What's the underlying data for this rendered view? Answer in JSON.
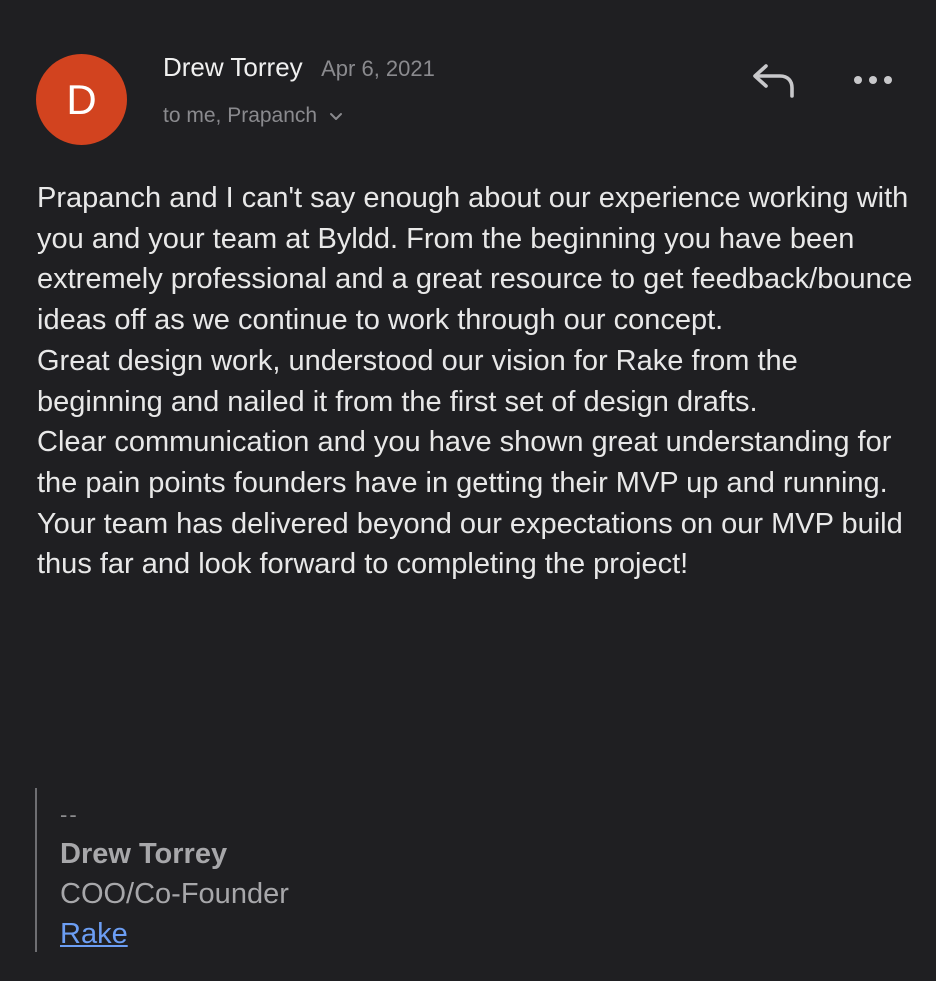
{
  "sender": {
    "initial": "D",
    "name": "Drew Torrey",
    "date": "Apr 6, 2021",
    "recipients": "to me, Prapanch"
  },
  "actions": {
    "reply_icon": "reply-icon",
    "more_icon": "more-horizontal-icon"
  },
  "body": {
    "paragraphs": [
      "Prapanch and I can't say enough about our experience working with you and your team at Byldd. From the beginning you have been extremely professional and a great resource to get feedback/bounce ideas off as we continue to work through our concept.",
      "Great design work, understood our vision for Rake from the beginning and nailed it from the first set of design drafts.",
      "Clear communication and you have shown great understanding for the pain points founders have in getting their MVP up and running.",
      "Your team has delivered beyond our expectations on our MVP build thus far and look forward to completing the project!"
    ]
  },
  "signature": {
    "separator": "--",
    "name": "Drew Torrey",
    "title": "COO/Co-Founder",
    "link_text": "Rake"
  },
  "colors": {
    "background": "#1f1f22",
    "avatar": "#d2431f",
    "link": "#6c9ef4"
  }
}
